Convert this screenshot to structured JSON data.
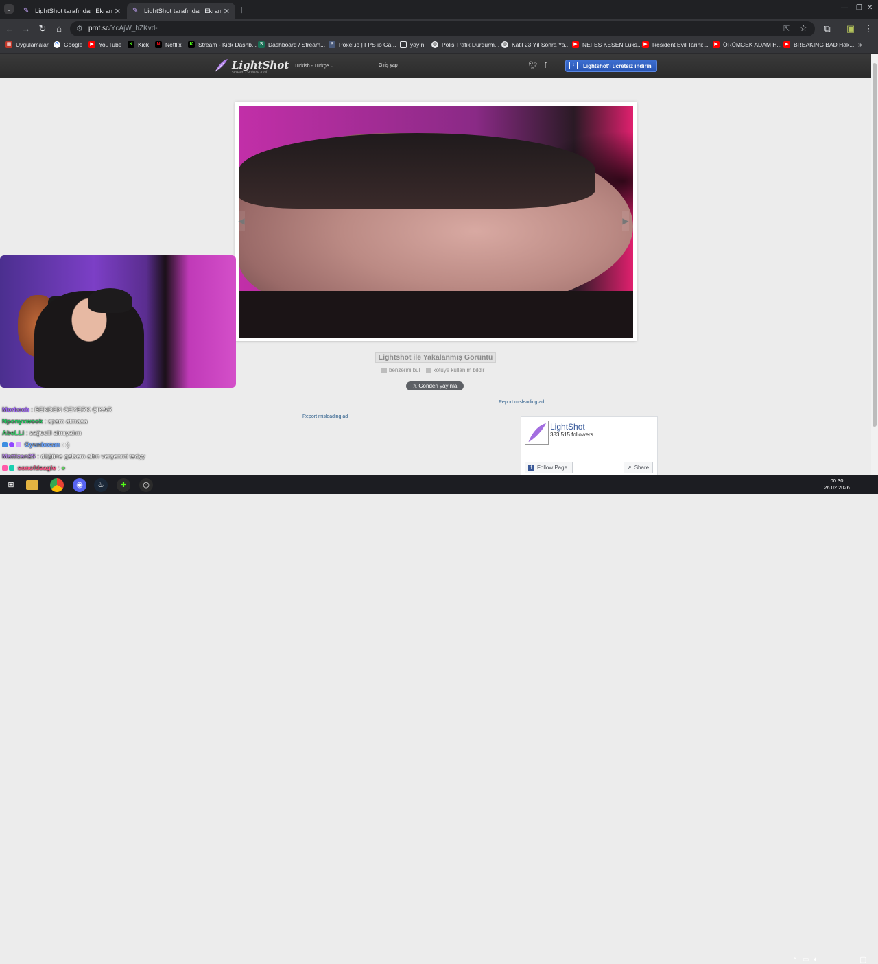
{
  "browser": {
    "tabs": [
      {
        "label": "LightShot tarafından Ekran Görü",
        "active": false
      },
      {
        "label": "LightShot tarafından Ekran Görü",
        "active": true
      }
    ],
    "url_domain": "prnt.sc",
    "url_path": "/YcAjW_hZKvd-"
  },
  "bookmarks": [
    {
      "label": "Uygulamalar",
      "icon": "apps-grid-icon",
      "color": "#e8eaed"
    },
    {
      "label": "Google",
      "icon": "google-icon",
      "color": "#ffffff"
    },
    {
      "label": "YouTube",
      "icon": "youtube-icon",
      "color": "#ff0000"
    },
    {
      "label": "Kick",
      "icon": "kick-icon",
      "color": "#53fc18"
    },
    {
      "label": "Netflix",
      "icon": "netflix-icon",
      "color": "#e50914"
    },
    {
      "label": "Stream - Kick Dashb...",
      "icon": "kick-icon",
      "color": "#53fc18"
    },
    {
      "label": "Dashboard / Stream...",
      "icon": "streamelements-icon",
      "color": "#3fd6a0"
    },
    {
      "label": "Poxel.io | FPS io Ga...",
      "icon": "poxel-icon",
      "color": "#8ab4f8"
    },
    {
      "label": "yayın",
      "icon": "folder-icon",
      "color": "#e8eaed"
    },
    {
      "label": "Polis Trafik Durdurm...",
      "icon": "globe-icon",
      "color": "#e8eaed"
    },
    {
      "label": "Katil 23 Yıl Sonra Ya...",
      "icon": "globe-icon",
      "color": "#e8eaed"
    },
    {
      "label": "NEFES KESEN Lüks...",
      "icon": "youtube-icon",
      "color": "#ff0000"
    },
    {
      "label": "Resident Evil Tarihi:...",
      "icon": "youtube-icon",
      "color": "#ff0000"
    },
    {
      "label": "ÖRÜMCEK ADAM H...",
      "icon": "youtube-icon",
      "color": "#ff0000"
    },
    {
      "label": "BREAKING BAD Hak...",
      "icon": "youtube-icon",
      "color": "#ff0000"
    }
  ],
  "lightshot": {
    "logo": "LightShot",
    "tagline": "screen capture tool",
    "language": "Turkish - Türkçe",
    "login": "Giriş yap",
    "download": "Lightshot'ı ücretsiz indirin",
    "caption": "Lightshot ile Yakalanmış Görüntü",
    "find_similar": "benzerini bul",
    "report_abuse": "kötüye kullanım bildir",
    "post_tweet": "Gönderi yayınla",
    "report_ad": "Report misleading ad"
  },
  "facebook": {
    "page_name": "LightShot",
    "followers": "383,515 followers",
    "follow": "Follow Page",
    "share": "Share"
  },
  "chat": [
    {
      "user": "Morkoch",
      "color": "#a66bff",
      "message": ": BENDEN CEYERK ÇIKAR"
    },
    {
      "user": "Nponyxwook",
      "color": "#19d05d",
      "message": ": spam atmaaa"
    },
    {
      "user": "AbeLLi",
      "color": "#3ecf6e",
      "message": ": sağoolll almıyalım"
    },
    {
      "user": "Oyunbozan",
      "color": "#6ea7ff",
      "message": ": :)"
    },
    {
      "user": "Mattizan25",
      "color": "#b88ae8",
      "message": ": düğüne gelsem altın verşenmi tedyy"
    },
    {
      "user": "sonofdeagle",
      "color": "#ff5a8a",
      "message": ":"
    }
  ],
  "taskbar": {
    "time": "00:30",
    "date": "26.02.2026"
  }
}
